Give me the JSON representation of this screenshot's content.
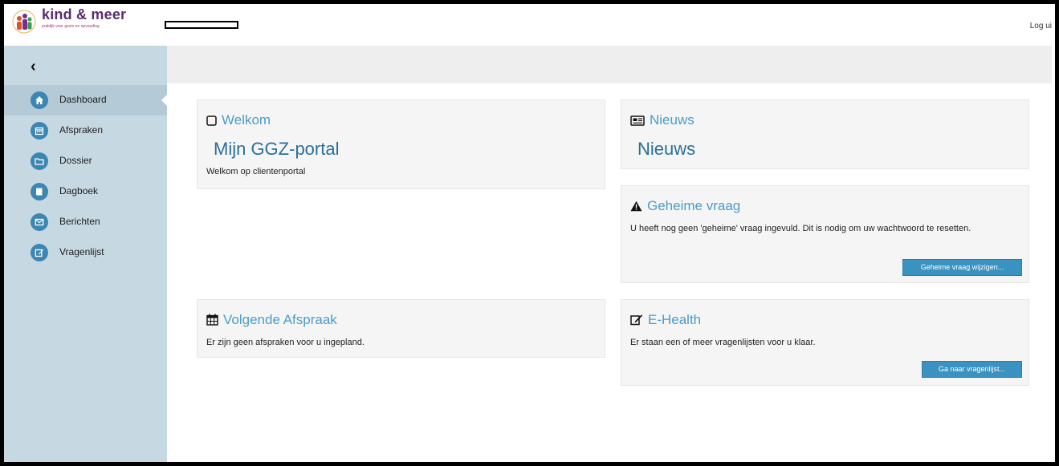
{
  "header": {
    "logo_title": "kind & meer",
    "logo_tagline": "praktijk voor gezin en opvoeding",
    "logout_label": "Log ui"
  },
  "sidebar": {
    "collapse_icon": "chevron-left-icon",
    "items": [
      {
        "label": "Dashboard",
        "icon": "home-icon",
        "active": true
      },
      {
        "label": "Afspraken",
        "icon": "calendar-icon"
      },
      {
        "label": "Dossier",
        "icon": "folder-icon"
      },
      {
        "label": "Dagboek",
        "icon": "book-icon"
      },
      {
        "label": "Berichten",
        "icon": "envelope-icon"
      },
      {
        "label": "Vragenlijst",
        "icon": "edit-icon"
      }
    ]
  },
  "panels": {
    "welkom": {
      "title": "Welkom",
      "heading": "Mijn GGZ-portal",
      "text": "Welkom op clientenportal"
    },
    "nieuws": {
      "title": "Nieuws",
      "heading": "Nieuws"
    },
    "geheime_vraag": {
      "title": "Geheime vraag",
      "text": "U heeft nog geen 'geheime' vraag ingevuld. Dit is nodig om uw wachtwoord te resetten.",
      "button": "Geheime vraag wijzigen..."
    },
    "afspraak": {
      "title": "Volgende Afspraak",
      "text": "Er zijn geen afspraken voor u ingepland."
    },
    "ehealth": {
      "title": "E-Health",
      "text": "Er staan een of meer vragenlijsten voor u klaar.",
      "button": "Ga naar vragenlijst..."
    }
  },
  "colors": {
    "sidebar": "#c6d9e3",
    "accent": "#3a92c1",
    "title": "#4a9dc8",
    "heading": "#2a6f99",
    "brand": "#5a2c6e"
  }
}
